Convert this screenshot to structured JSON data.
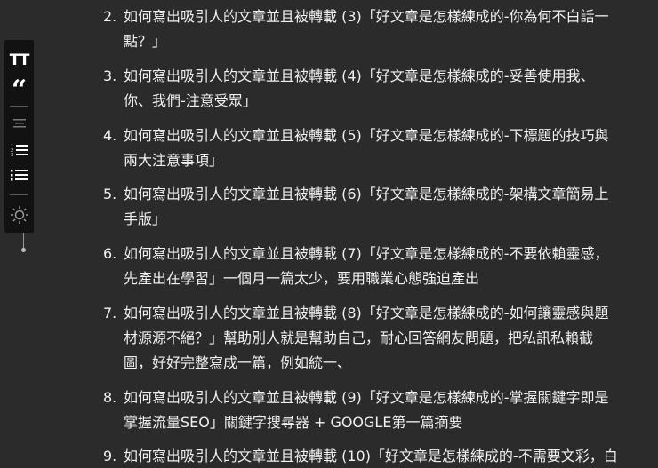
{
  "toolbar": {
    "font_size_glyph": "TT",
    "quote_glyph": "“",
    "tools": [
      {
        "name": "text-align-center-icon"
      },
      {
        "name": "numbered-list-icon"
      },
      {
        "name": "bullet-list-icon"
      },
      {
        "name": "brightness-icon"
      }
    ]
  },
  "list": {
    "items": [
      {
        "number": "2.",
        "lines": [
          "如何寫出吸引人的文章並且被轉載 (3)「好文章是怎樣練成的-你為何不白話一",
          "點？」"
        ]
      },
      {
        "number": "3.",
        "lines": [
          "如何寫出吸引人的文章並且被轉載 (4)「好文章是怎樣練成的-妥善使用我、",
          "你、我們-注意受眾」"
        ]
      },
      {
        "number": "4.",
        "lines": [
          "如何寫出吸引人的文章並且被轉載 (5)「好文章是怎樣練成的-下標題的技巧與",
          "兩大注意事項」"
        ]
      },
      {
        "number": "5.",
        "lines": [
          "如何寫出吸引人的文章並且被轉載 (6)「好文章是怎樣練成的-架構文章簡易上",
          "手版」"
        ]
      },
      {
        "number": "6.",
        "lines": [
          "如何寫出吸引人的文章並且被轉載 (7)「好文章是怎樣練成的-不要依賴靈感，",
          "先產出在學習」一個月一篇太少，要用職業心態強迫產出"
        ]
      },
      {
        "number": "7.",
        "lines": [
          "如何寫出吸引人的文章並且被轉載 (8)「好文章是怎樣練成的-如何讓靈感與題",
          "材源源不絕？」幫助別人就是幫助自己，耐心回答網友問題，把私訊私賴截",
          "圖，好好完整寫成一篇，例如統一、"
        ]
      },
      {
        "number": "8.",
        "lines": [
          "如何寫出吸引人的文章並且被轉載 (9)「好文章是怎樣練成的-掌握關鍵字即是",
          "掌握流量SEO」關鍵字搜尋器 + GOOGLE第一篇摘要"
        ]
      },
      {
        "number": "9.",
        "lines": [
          "如何寫出吸引人的文章並且被轉載 (10)「好文章是怎樣練成的-不需要文彩，白"
        ]
      }
    ]
  }
}
